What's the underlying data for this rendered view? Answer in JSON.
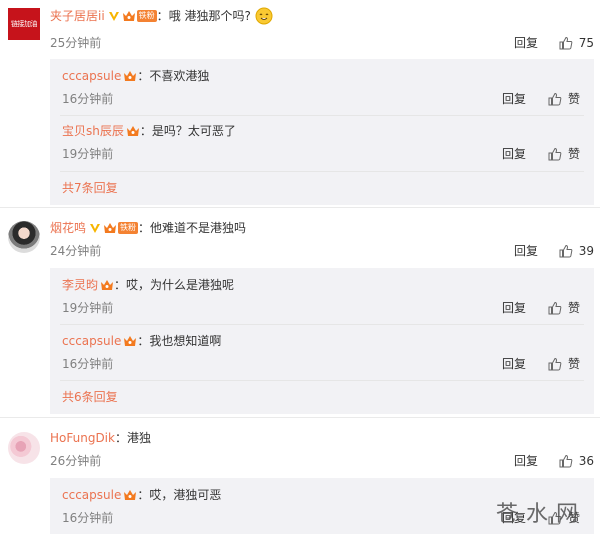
{
  "comments": [
    {
      "username": "夹子居居ii",
      "colon": "：",
      "text": "哦 港独那个吗?",
      "fans_badge": "铁粉",
      "avatar_text": "链接加油",
      "time": "25分钟前",
      "reply_label": "回复",
      "like_count": "75",
      "replies": [
        {
          "username": "cccapsule",
          "colon": "：",
          "text": "不喜欢港独",
          "time": "16分钟前",
          "reply_label": "回复",
          "like_label": "赞"
        },
        {
          "username": "宝贝sh辰辰",
          "colon": "：",
          "text": "是吗？太可恶了",
          "time": "19分钟前",
          "reply_label": "回复",
          "like_label": "赞"
        }
      ],
      "more": "共7条回复"
    },
    {
      "username": "烟花鸣",
      "colon": "：",
      "text": "他难道不是港独吗",
      "fans_badge": "铁粉",
      "time": "24分钟前",
      "reply_label": "回复",
      "like_count": "39",
      "replies": [
        {
          "username": "李灵昀",
          "colon": "：",
          "text": "哎，为什么是港独呢",
          "time": "19分钟前",
          "reply_label": "回复",
          "like_label": "赞"
        },
        {
          "username": "cccapsule",
          "colon": "：",
          "text": "我也想知道啊",
          "time": "16分钟前",
          "reply_label": "回复",
          "like_label": "赞"
        }
      ],
      "more": "共6条回复"
    },
    {
      "username": "HoFungDik",
      "colon": "：",
      "text": "港独",
      "time": "26分钟前",
      "reply_label": "回复",
      "like_count": "36",
      "replies": [
        {
          "username": "cccapsule",
          "colon": "：",
          "text": "哎，港独可恶",
          "time": "16分钟前",
          "reply_label": "回复",
          "like_label": "赞"
        }
      ]
    }
  ],
  "watermark": "苍水网",
  "icons": {
    "like": "thumbs-up-icon",
    "verified": "verified-v-icon",
    "vip": "vip-crown-icon",
    "emoji": "cry-laugh-emoji-icon"
  },
  "colors": {
    "username": "#eb7350",
    "reply_box_bg": "#f2f2f5",
    "time": "#808080",
    "fans_badge": "#f48232"
  }
}
